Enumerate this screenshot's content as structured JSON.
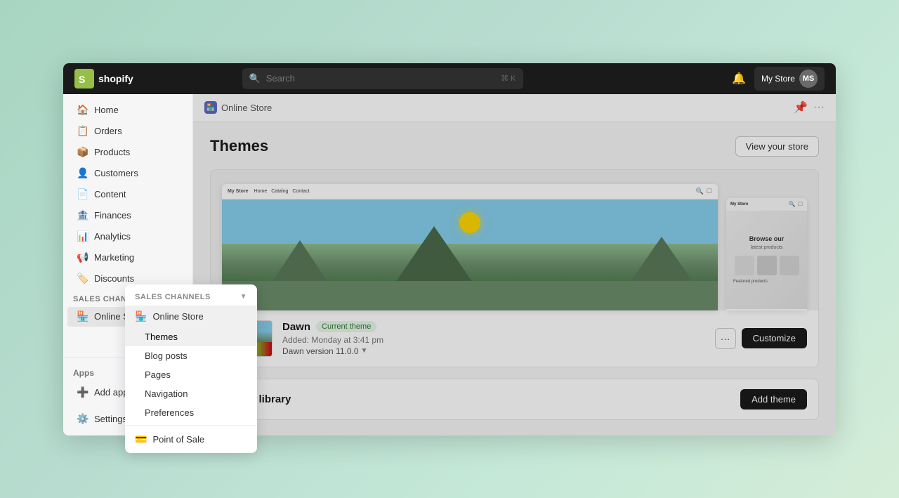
{
  "topbar": {
    "search_placeholder": "Search",
    "shortcut": "⌘ K",
    "store_name": "My Store",
    "logo_text": "shopify"
  },
  "breadcrumb": {
    "label": "Online Store"
  },
  "sidebar": {
    "items": [
      {
        "id": "home",
        "label": "Home",
        "icon": "🏠"
      },
      {
        "id": "orders",
        "label": "Orders",
        "icon": "📋"
      },
      {
        "id": "products",
        "label": "Products",
        "icon": "📦"
      },
      {
        "id": "customers",
        "label": "Customers",
        "icon": "👤"
      },
      {
        "id": "content",
        "label": "Content",
        "icon": "📄"
      },
      {
        "id": "finances",
        "label": "Finances",
        "icon": "🏦"
      },
      {
        "id": "analytics",
        "label": "Analytics",
        "icon": "📊"
      },
      {
        "id": "marketing",
        "label": "Marketing",
        "icon": "📢"
      },
      {
        "id": "discounts",
        "label": "Discounts",
        "icon": "🏷️"
      }
    ],
    "sales_channels_label": "Sales channels",
    "sales_channels_items": [
      {
        "id": "online-store",
        "label": "Online Store",
        "icon": "🏪"
      }
    ],
    "apps_label": "Apps",
    "add_apps_label": "Add apps",
    "settings_label": "Settings"
  },
  "dropdown": {
    "header": "Sales channels",
    "items": [
      {
        "id": "online-store",
        "label": "Online Store",
        "icon": "🏪"
      },
      {
        "id": "themes",
        "label": "Themes",
        "active": true
      },
      {
        "id": "blog-posts",
        "label": "Blog posts"
      },
      {
        "id": "pages",
        "label": "Pages"
      },
      {
        "id": "navigation",
        "label": "Navigation"
      },
      {
        "id": "preferences",
        "label": "Preferences"
      }
    ],
    "point_of_sale": "Point of Sale",
    "point_of_sale_icon": "💳"
  },
  "page": {
    "title": "Themes",
    "view_store_btn": "View your store",
    "theme_name": "Dawn",
    "current_badge": "Current theme",
    "theme_added": "Added: Monday at 3:41 pm",
    "theme_version": "Dawn version 11.0.0",
    "customize_btn": "Customize",
    "more_btn": "···",
    "library_title": "Theme library",
    "add_theme_btn": "Add theme"
  }
}
